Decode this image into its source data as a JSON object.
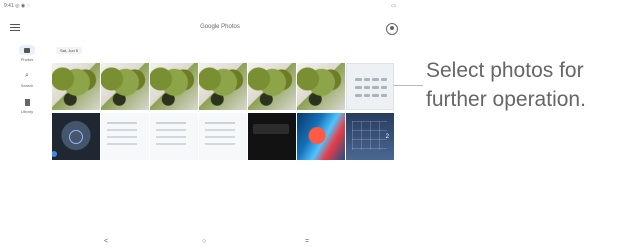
{
  "status_bar": {
    "left_text": "9:41 ◎ ◉ ◌",
    "right_text": "▭"
  },
  "header": {
    "title": "Google Photos",
    "menu_icon": "menu-icon",
    "account_icon": "account-icon"
  },
  "rail": {
    "items": [
      {
        "label": "Photos",
        "icon": "photos-icon"
      },
      {
        "label": "Search",
        "icon": "search-icon"
      },
      {
        "label": "Library",
        "icon": "library-icon"
      }
    ]
  },
  "grid": {
    "date_label": "Sat, Jun 5",
    "photos": [
      {
        "label": "plant-photo-1"
      },
      {
        "label": "plant-photo-2"
      },
      {
        "label": "plant-photo-3"
      },
      {
        "label": "plant-photo-4"
      },
      {
        "label": "plant-photo-5"
      },
      {
        "label": "plant-photo-6"
      },
      {
        "label": "keypad-screenshot"
      },
      {
        "label": "clock-screenshot"
      },
      {
        "label": "settings-screenshot-1"
      },
      {
        "label": "settings-screenshot-2"
      },
      {
        "label": "settings-screenshot-3"
      },
      {
        "label": "dark-screenshot"
      },
      {
        "label": "wallpaper-photo"
      },
      {
        "label": "grid-screenshot",
        "badge": "2"
      }
    ]
  },
  "navigation": {
    "back": "<",
    "home": "○",
    "menu": "="
  },
  "caption": {
    "line1": "Select photos for",
    "line2": "further operation."
  },
  "colors": {
    "accent": "#4285f4",
    "caption_text": "#666666",
    "rail_active": "#e8f0fe"
  }
}
